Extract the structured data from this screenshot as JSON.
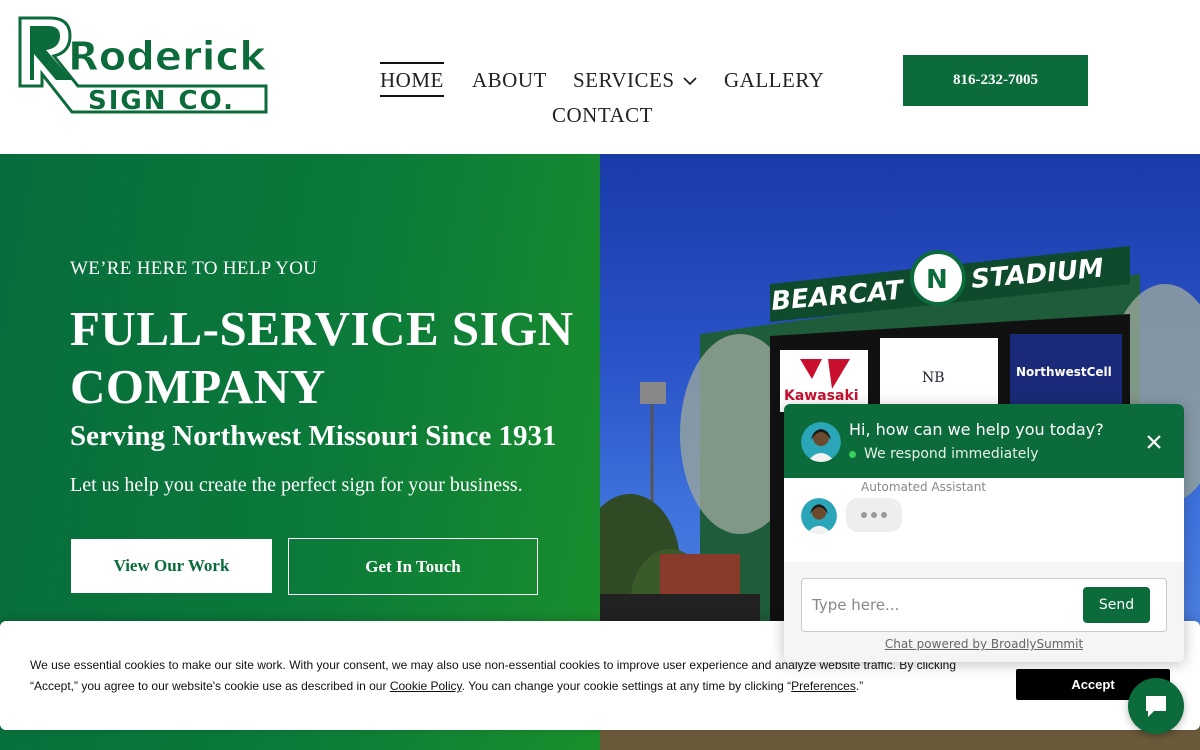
{
  "brand": {
    "logo_line1": "Roderick",
    "logo_line2": "SIGN CO.",
    "primary_color": "#0b6b3a"
  },
  "nav": {
    "items": [
      {
        "label": "HOME",
        "active": true
      },
      {
        "label": "ABOUT"
      },
      {
        "label": "SERVICES",
        "has_dropdown": true,
        "icon": "chevron-down-icon"
      },
      {
        "label": "GALLERY"
      },
      {
        "label": "CONTACT"
      }
    ],
    "phone": "816-232-7005"
  },
  "hero": {
    "eyebrow": "WE’RE HERE TO HELP YOU",
    "title": "FULL-SERVICE SIGN COMPANY",
    "subtitle": "Serving Northwest Missouri Since 1931",
    "text": "Let us help you create the perfect sign for your business.",
    "primary_button": "View Our Work",
    "secondary_button": "Get In Touch",
    "image": {
      "stadium_name_left": "BEARCAT",
      "stadium_name_right": "STADIUM",
      "logo_letter": "N",
      "sponsors": [
        "Kawasaki",
        "NB",
        "NorthwestCell"
      ]
    }
  },
  "cookie": {
    "text_1": "We use essential cookies to make our site work. With your consent, we may also use non-essential cookies to improve user experience and analyze website traffic. By clicking “Accept,” you agree to our website's cookie use as described in our ",
    "policy_link": "Cookie Policy",
    "text_2": ". You can change your cookie settings at any time by clicking “",
    "preferences_link": "Preferences",
    "text_3": ".”",
    "accept_label": "Accept"
  },
  "chat": {
    "title": "Hi, how can we help you today?",
    "status": "We respond immediately",
    "assistant_label": "Automated Assistant",
    "input_placeholder": "Type here...",
    "send_label": "Send",
    "powered_by": "Chat powered by BroadlySummit"
  }
}
